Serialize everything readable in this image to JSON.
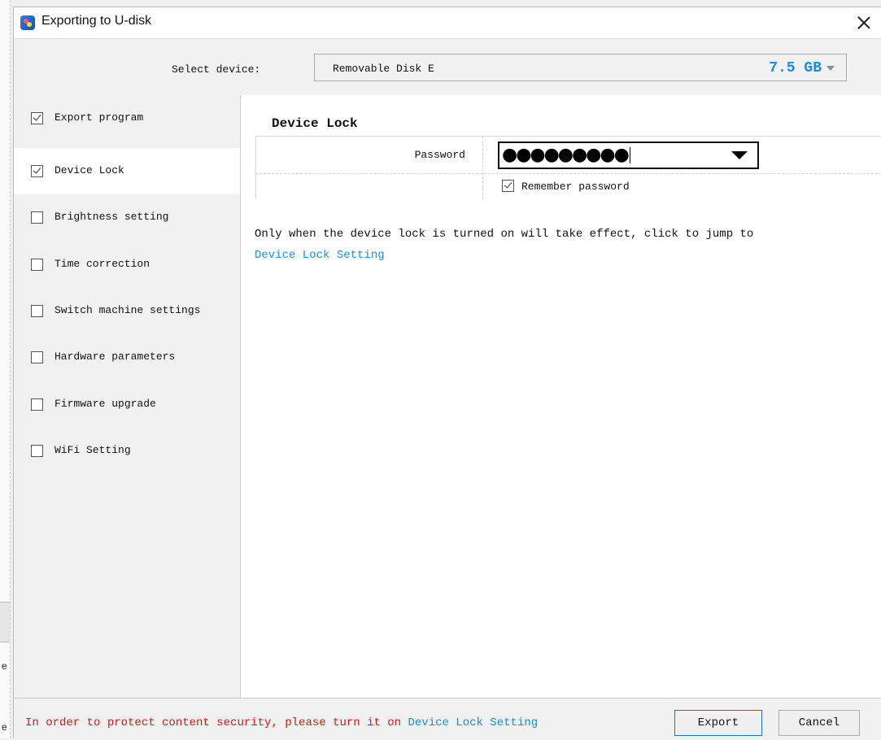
{
  "window": {
    "title": "Exporting to U-disk"
  },
  "device": {
    "select_label": "Select device:",
    "name": "Removable Disk E",
    "size": "7.5 GB"
  },
  "sidebar": {
    "items": [
      {
        "label": "Export program",
        "checked": true
      },
      {
        "label": "Device Lock",
        "checked": true,
        "active": true
      },
      {
        "label": "Brightness setting",
        "checked": false
      },
      {
        "label": "Time correction",
        "checked": false
      },
      {
        "label": "Switch machine settings",
        "checked": false
      },
      {
        "label": "Hardware parameters",
        "checked": false
      },
      {
        "label": "Firmware upgrade",
        "checked": false
      },
      {
        "label": "WiFi Setting",
        "checked": false
      }
    ]
  },
  "main": {
    "section_title": "Device Lock",
    "password_label": "Password",
    "password_value": "●●●●●●●●●",
    "remember_label": "Remember password",
    "remember_checked": true,
    "info_text": "Only when the device lock is turned on will take effect, click to jump to",
    "info_link": "Device Lock Setting"
  },
  "footer": {
    "warning": "In order to protect content security, please turn it on ",
    "warning_link": "Device Lock Setting",
    "export_label": "Export",
    "cancel_label": "Cancel"
  },
  "background": {
    "fragment_1": "e",
    "fragment_2": "e"
  },
  "colors": {
    "link": "#1a8de0",
    "warning": "#e81010"
  }
}
